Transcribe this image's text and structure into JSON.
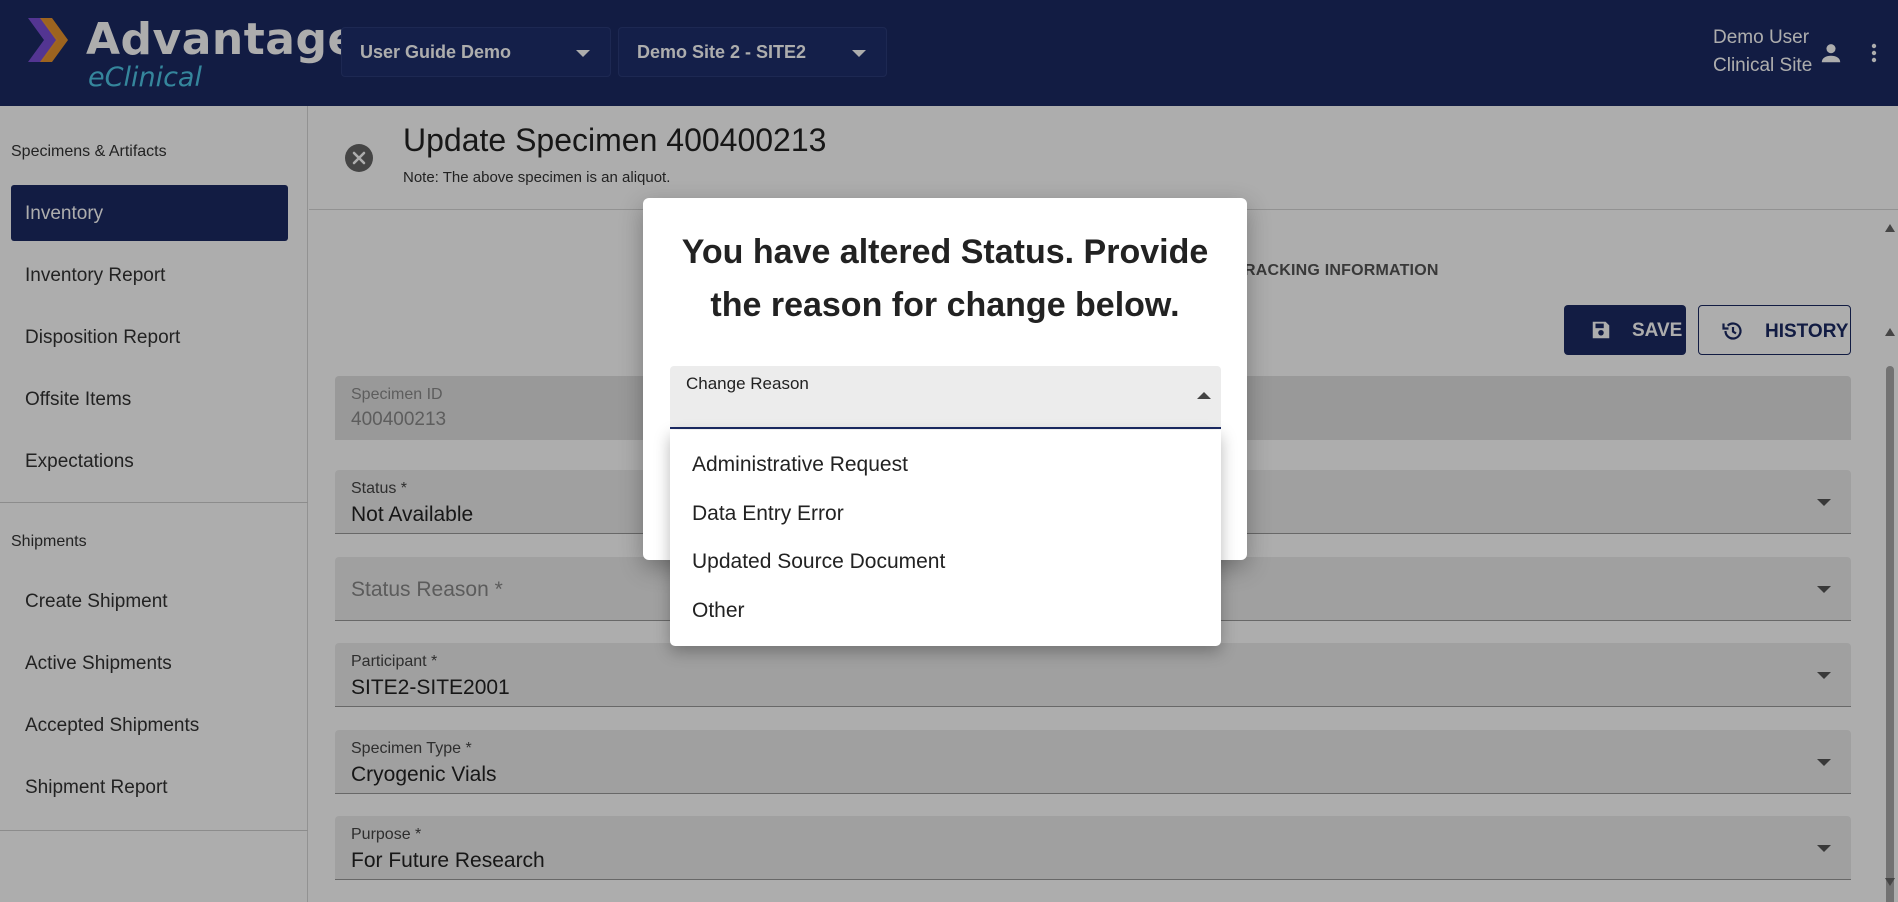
{
  "header": {
    "logo_title": "Advantage",
    "logo_subtitle": "eClinical",
    "study_select": "User Guide Demo",
    "site_select": "Demo Site 2 - SITE2",
    "user_name": "Demo User",
    "user_role": "Clinical Site"
  },
  "sidebar": {
    "section1_title": "Specimens & Artifacts",
    "section1_items": [
      "Inventory",
      "Inventory Report",
      "Disposition Report",
      "Offsite Items",
      "Expectations"
    ],
    "section2_title": "Shipments",
    "section2_items": [
      "Create Shipment",
      "Active Shipments",
      "Accepted Shipments",
      "Shipment Report"
    ],
    "active_item": "Inventory"
  },
  "main": {
    "title": "Update Specimen 400400213",
    "note": "Note: The above specimen is an aliquot.",
    "tab_partial": "RACKING INFORMATION",
    "save_label": "SAVE",
    "history_label": "HISTORY",
    "fields": {
      "specimen_id_label": "Specimen ID",
      "specimen_id_value": "400400213",
      "status_label": "Status *",
      "status_value": "Not Available",
      "status_reason_placeholder": "Status Reason *",
      "participant_label": "Participant *",
      "participant_value": "SITE2-SITE2001",
      "specimen_type_label": "Specimen Type *",
      "specimen_type_value": "Cryogenic Vials",
      "purpose_label": "Purpose *",
      "purpose_value": "For Future Research"
    }
  },
  "dialog": {
    "title": "You have altered Status. Provide the reason for change below.",
    "field_label": "Change Reason",
    "options": [
      "Administrative Request",
      "Data Entry Error",
      "Updated Source Document",
      "Other"
    ]
  },
  "colors": {
    "brand_navy": "#1b2a63",
    "accent_cyan": "#4fc6e6",
    "accent_orange": "#f39a2b",
    "accent_purple": "#7b4fd8"
  }
}
